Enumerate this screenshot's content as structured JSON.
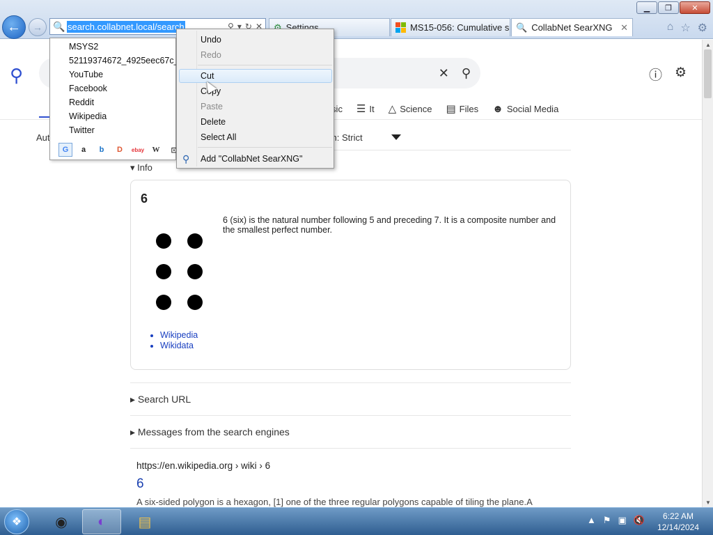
{
  "window": {
    "minimize_glyph": "▁",
    "restore_glyph": "❐",
    "close_glyph": "✕"
  },
  "toolbar": {
    "back_glyph": "←",
    "forward_glyph": "→",
    "address_value": "search.collabnet.local/search",
    "address_icons": [
      "search-icon",
      "dropdown-icon",
      "refresh-icon",
      "stop-icon"
    ],
    "right_icons": [
      "home-icon",
      "star-icon",
      "gear-icon"
    ]
  },
  "tabs": [
    {
      "label": "Settings",
      "icon": "settings-icon"
    },
    {
      "label": "MS15-056: Cumulative s...",
      "icon": "microsoft-logo-icon"
    },
    {
      "label": "CollabNet SearXNG",
      "icon": "search-icon",
      "active": true
    }
  ],
  "autocomplete": {
    "items": [
      "MSYS2",
      "52119374672_4925eec67c_w.jpg",
      "YouTube",
      "Facebook",
      "Reddit",
      "Wikipedia",
      "Twitter"
    ],
    "engines": [
      {
        "glyph": "G",
        "name": "google-icon",
        "color": "#4285f4",
        "selected": true
      },
      {
        "glyph": "a",
        "name": "amazon-icon",
        "color": "#222222"
      },
      {
        "glyph": "b",
        "name": "bing-icon",
        "color": "#1a73c8"
      },
      {
        "glyph": "D",
        "name": "duckduckgo-icon",
        "color": "#de5833"
      },
      {
        "glyph": "ebay",
        "name": "ebay-icon",
        "color": "#e53238"
      },
      {
        "glyph": "W",
        "name": "wikipedia-icon",
        "color": "#333333"
      },
      {
        "glyph": "⊡",
        "name": "search-engine-icon",
        "color": "#333333"
      }
    ]
  },
  "context_menu": {
    "undo": "Undo",
    "redo": "Redo",
    "cut": "Cut",
    "copy": "Copy",
    "paste": "Paste",
    "delete": "Delete",
    "select_all": "Select All",
    "add_engine": "Add \"CollabNet SearXNG\""
  },
  "page": {
    "categories": [
      {
        "label": "Music",
        "icon": "music-icon"
      },
      {
        "label": "It",
        "icon": "layers-icon"
      },
      {
        "label": "Science",
        "icon": "science-icon"
      },
      {
        "label": "Files",
        "icon": "files-icon"
      },
      {
        "label": "Social Media",
        "icon": "social-media-icon"
      }
    ],
    "filter_left": "Aut",
    "safe_search": "ch: Strict",
    "info_summary": "▾ Info",
    "info_title": "6",
    "info_description": "6 (six) is the natural number following 5 and preceding 7. It is a composite number and the smallest perfect number.",
    "info_links": [
      "Wikipedia",
      "Wikidata"
    ],
    "search_url": "▸ Search URL",
    "messages": "▸ Messages from the search engines",
    "result_url": "https://en.wikipedia.org  › wiki › 6",
    "result_title": "6",
    "result_snippet": "A six-sided polygon is a hexagon, [1] one of the three regular polygons capable of tiling the plane.A"
  },
  "taskbar": {
    "clock_time": "6:22 AM",
    "clock_date": "12/14/2024"
  }
}
